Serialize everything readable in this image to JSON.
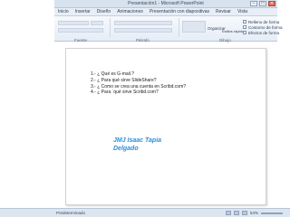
{
  "window": {
    "title": "Presentación1 - Microsoft PowerPoint",
    "controls": [
      "–",
      "□",
      "✕"
    ]
  },
  "tabs": [
    "Inicio",
    "Insertar",
    "Diseño",
    "Animaciones",
    "Presentación con diapositivas",
    "Revisar",
    "Vista"
  ],
  "ribbon": {
    "groups": [
      "Fuente",
      "Párrafo",
      "Dibujo"
    ],
    "items": [
      "Relleno de forma",
      "Contorno de forma",
      "Efectos de forma",
      "Organizar",
      "Estilos rápidos"
    ]
  },
  "slide": {
    "questions": [
      "1.- ¿ Qué es G-mail.?",
      "2.- ¿ Para qué sirve SlideShare?",
      "3.- ¿ Como se crea una cuenta en Scribd.com?",
      "4.- ¿ Para `qué sirve Scribd.com?"
    ],
    "author_line1": "JMJ  Isaac Tapia",
    "author_line2": "Delgado"
  },
  "status": {
    "left_text": "Predeterminado",
    "zoom": "54%"
  },
  "colors": {
    "author_text": "#2b8fd6"
  }
}
